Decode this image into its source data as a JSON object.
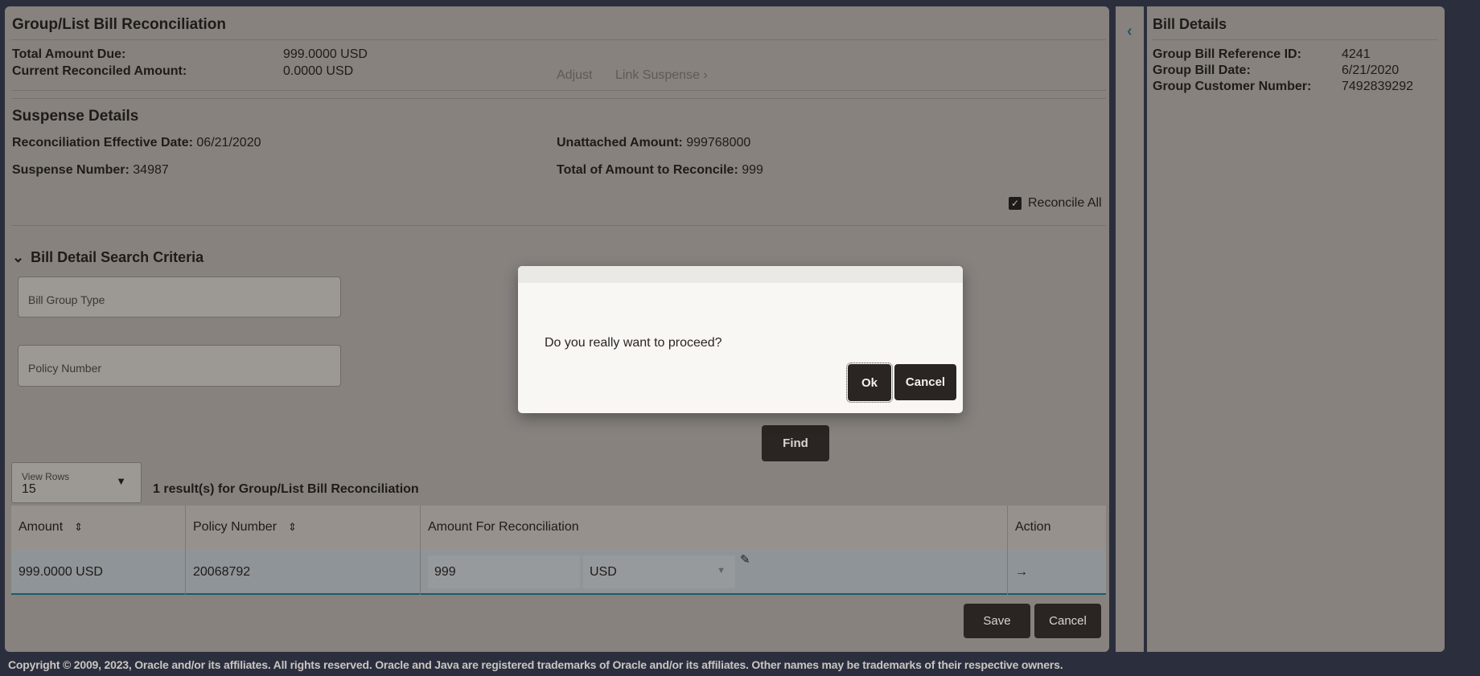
{
  "main": {
    "title": "Group/List Bill Reconciliation",
    "total_due_label": "Total Amount Due:",
    "total_due_value": "999.0000 USD",
    "reconciled_label": "Current Reconciled Amount:",
    "reconciled_value": "0.0000 USD",
    "adjust": "Adjust",
    "link_suspense": "Link Suspense",
    "suspense": {
      "title": "Suspense Details",
      "eff_date_label": "Reconciliation Effective Date:",
      "eff_date_value": "06/21/2020",
      "suspense_no_label": "Suspense Number:",
      "suspense_no_value": "34987",
      "unattached_label": "Unattached Amount:",
      "unattached_value": "999768000",
      "total_reconcile_label": "Total of Amount to Reconcile:",
      "total_reconcile_value": "999",
      "reconcile_all": "Reconcile All",
      "reconcile_all_checked": true
    },
    "search": {
      "title": "Bill Detail Search Criteria",
      "bill_group_type": "Bill Group Type",
      "policy_number": "Policy Number",
      "find": "Find"
    },
    "view_rows_label": "View Rows",
    "view_rows_value": "15",
    "result_text": "1 result(s) for Group/List Bill Reconciliation",
    "table": {
      "headers": [
        "Amount",
        "Policy Number",
        "Amount For Reconciliation",
        "Action"
      ],
      "rows": [
        {
          "amount": "999.0000 USD",
          "policy": "20068792",
          "recon_amount": "999",
          "currency": "USD"
        }
      ]
    },
    "save": "Save",
    "cancel": "Cancel"
  },
  "bill_details": {
    "title": "Bill Details",
    "ref_label": "Group Bill Reference ID:",
    "ref_value": "4241",
    "date_label": "Group Bill Date:",
    "date_value": "6/21/2020",
    "cust_label": "Group Customer Number:",
    "cust_value": "7492839292"
  },
  "dialog": {
    "message": "Do you really want to proceed?",
    "ok": "Ok",
    "cancel": "Cancel"
  },
  "footer": "Copyright © 2009, 2023, Oracle and/or its affiliates. All rights reserved. Oracle and Java are registered trademarks of Oracle and/or its affiliates. Other names may be trademarks of their respective owners.",
  "colors": {
    "page_bg": "#2b2e3d",
    "panel": "#87827e",
    "button": "#2a2522",
    "accent": "#1d5a6a"
  }
}
